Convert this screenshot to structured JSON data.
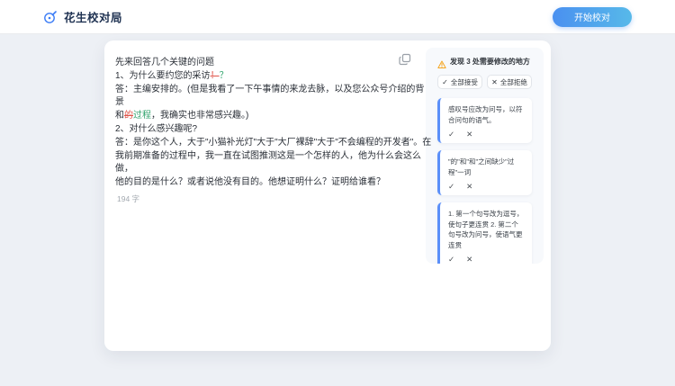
{
  "header": {
    "title": "花生校对局",
    "start_button": "开始校对"
  },
  "colors": {
    "accent_blue": "#4a90f0",
    "deletion_red": "#e0554a",
    "addition_green": "#2fa36b",
    "warning_orange": "#f5a623",
    "suggestion_accent": "#5b8ff9",
    "page_background": "#edf0f5"
  },
  "icons": {
    "check": "✓",
    "cross": "✕"
  },
  "editor": {
    "word_count": "194 字",
    "segments": [
      {
        "type": "normal",
        "text": "先来回答几个关键的问题\n1、为什么要约您的采访"
      },
      {
        "type": "deleted",
        "text": "！"
      },
      {
        "type": "added",
        "text": "？"
      },
      {
        "type": "normal",
        "text": "\n答：主编安排的。(但是我看了一下午事情的来龙去脉，以及您公众号介绍的背景\n和"
      },
      {
        "type": "deleted",
        "text": "的"
      },
      {
        "type": "added",
        "text": "过程"
      },
      {
        "type": "normal",
        "text": "，我确实也非常感兴趣。)\n2、对什么感兴趣呢?\n答：是你这个人，大于\"小猫补光灯\"大于\"大厂裸辞\"大于\"不会编程的开发者\"。在\n我前期准备的过程中，我一直在试图推测这是一个怎样的人，他为什么会这么做，\n他的目的是什么？或者说他没有目的。他想证明什么？证明给谁看？"
      }
    ]
  },
  "suggestions": {
    "header": "发现 3 处需要修改的地方",
    "accept_all": "全部接受",
    "reject_all": "全部拒绝",
    "items": [
      {
        "text": "感叹号应改为问号，以符合问句的语气。"
      },
      {
        "text": "\"的\"和\"和\"之间缺少\"过程\"一词"
      },
      {
        "text": "1. 第一个句号改为逗号，使句子更连贯 2. 第二个句号改为问号，使语气更连贯"
      }
    ]
  }
}
